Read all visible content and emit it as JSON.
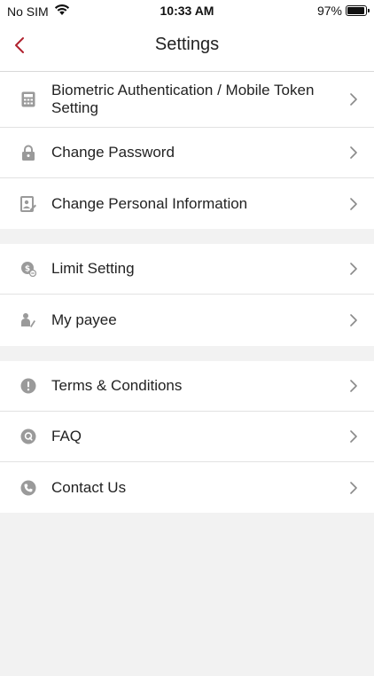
{
  "status_bar": {
    "carrier": "No SIM",
    "time": "10:33 AM",
    "battery": "97%",
    "battery_level": 0.97
  },
  "header": {
    "title": "Settings"
  },
  "colors": {
    "accent": "#b0222e",
    "icon": "#9a9a9a",
    "chevron": "#8a8a8a",
    "background": "#f2f2f2"
  },
  "groups": [
    {
      "items": [
        {
          "icon": "calculator-icon",
          "label": "Biometric Authentication / Mobile Token Setting"
        },
        {
          "icon": "lock-icon",
          "label": "Change Password"
        },
        {
          "icon": "edit-profile-icon",
          "label": "Change Personal Information"
        }
      ]
    },
    {
      "items": [
        {
          "icon": "limit-icon",
          "label": "Limit Setting"
        },
        {
          "icon": "payee-icon",
          "label": "My payee"
        }
      ]
    },
    {
      "items": [
        {
          "icon": "info-icon",
          "label": "Terms & Conditions"
        },
        {
          "icon": "faq-icon",
          "label": "FAQ"
        },
        {
          "icon": "phone-icon",
          "label": "Contact Us"
        }
      ]
    }
  ]
}
